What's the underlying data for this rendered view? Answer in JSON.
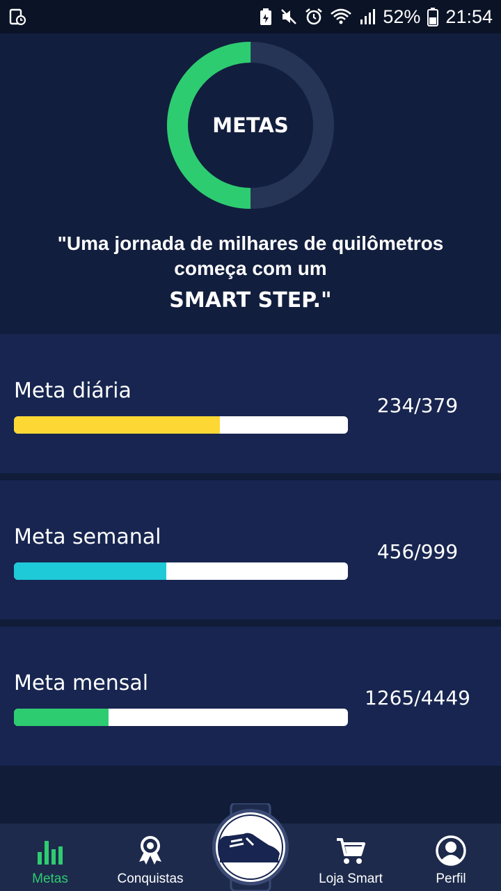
{
  "status_bar": {
    "battery": "52%",
    "time": "21:54",
    "icons": [
      "screen-record-icon",
      "battery-saver-icon",
      "mute-icon",
      "alarm-icon",
      "wifi-icon",
      "signal-icon",
      "battery-icon"
    ]
  },
  "hero": {
    "ring_label": "METAS",
    "ring_progress": 0.5,
    "quote_line1": "\"Uma jornada de milhares de quilômetros",
    "quote_line2": "começa com um",
    "quote_brand": "SMART STEP.\""
  },
  "goals": [
    {
      "label": "Meta diária",
      "value": "234/379",
      "current": 234,
      "target": 379,
      "color": "#fdd835"
    },
    {
      "label": "Meta semanal",
      "value": "456/999",
      "current": 456,
      "target": 999,
      "color": "#1ecad8"
    },
    {
      "label": "Meta mensal",
      "value": "1265/4449",
      "current": 1265,
      "target": 4449,
      "color": "#2ecc71"
    }
  ],
  "nav": {
    "items": [
      {
        "label": "Metas",
        "icon": "bar-chart-icon",
        "active": true
      },
      {
        "label": "Conquistas",
        "icon": "award-ribbon-icon",
        "active": false
      },
      {
        "label": "Loja Smart",
        "icon": "shopping-cart-icon",
        "active": false
      },
      {
        "label": "Perfil",
        "icon": "profile-icon",
        "active": false
      }
    ],
    "center_icon": "smart-shoe-watch-icon"
  },
  "colors": {
    "accent_green": "#2ecc71",
    "ring_track": "#263556",
    "background": "#101c38",
    "card": "#172550"
  }
}
